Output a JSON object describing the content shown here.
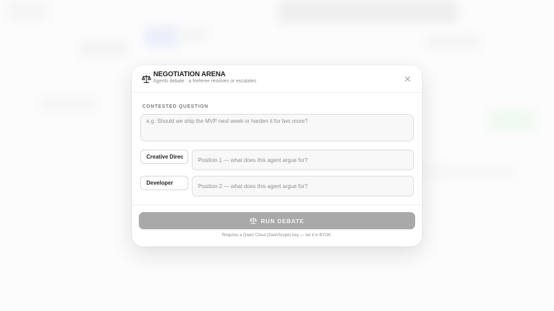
{
  "modal": {
    "title": "NEGOTIATION ARENA",
    "subtitle": "Agents debate · a Referee resolves or escalates",
    "icon": "scale-icon",
    "close_icon": "close-icon"
  },
  "question": {
    "label": "CONTESTED QUESTION",
    "placeholder": "e.g. Should we ship the MVP next week or harden it for two more?",
    "value": ""
  },
  "agents": [
    {
      "name": "Creative Direc",
      "position_placeholder": "Position 1 — what does this agent argue for?",
      "position_value": ""
    },
    {
      "name": "Developer",
      "position_placeholder": "Position 2 — what does this agent argue for?",
      "position_value": ""
    }
  ],
  "run_button": {
    "label": "RUN DEBATE",
    "icon": "scale-icon",
    "state": "disabled"
  },
  "note": "Requires a Qwen Cloud (DashScope) key — set it in BYOK.",
  "colors": {
    "modal_bg": "#ffffff",
    "run_button_bg": "#a9a9a9",
    "title_text": "#1c1c1c",
    "muted_text": "#8a8a8a"
  }
}
